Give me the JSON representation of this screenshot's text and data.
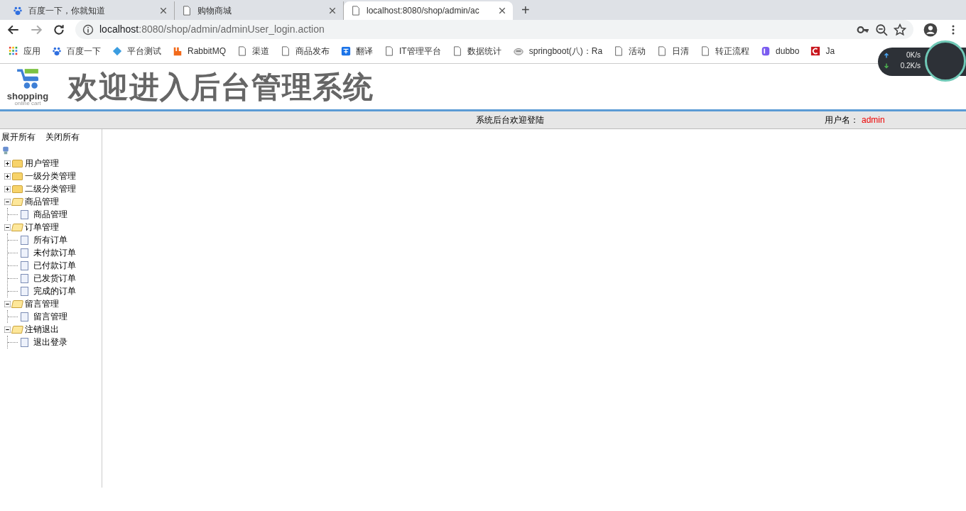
{
  "browser": {
    "tabs": [
      {
        "title": "百度一下，你就知道",
        "kind": "paw",
        "selected": false
      },
      {
        "title": "购物商城",
        "kind": "page",
        "selected": false
      },
      {
        "title": "localhost:8080/shop/admin/ac",
        "kind": "page",
        "selected": true
      }
    ],
    "new_tab": "+",
    "address": {
      "host": "localhost",
      "rest": ":8080/shop/admin/adminUser_login.action"
    },
    "bookmarks": [
      {
        "label": "应用",
        "kind": "apps"
      },
      {
        "label": "百度一下",
        "kind": "paw"
      },
      {
        "label": "平台测试",
        "kind": "diamond"
      },
      {
        "label": "RabbitMQ",
        "kind": "rabbit"
      },
      {
        "label": "渠道",
        "kind": "page"
      },
      {
        "label": "商品发布",
        "kind": "page"
      },
      {
        "label": "翻译",
        "kind": "translate"
      },
      {
        "label": "IT管理平台",
        "kind": "page"
      },
      {
        "label": "数据统计",
        "kind": "page"
      },
      {
        "label": "springboot(八)：Ra",
        "kind": "cloud"
      },
      {
        "label": "活动",
        "kind": "page"
      },
      {
        "label": "日清",
        "kind": "page"
      },
      {
        "label": "转正流程",
        "kind": "page"
      },
      {
        "label": "dubbo",
        "kind": "dubbo"
      },
      {
        "label": "Ja",
        "kind": "csdn"
      }
    ],
    "speed": {
      "up": "0",
      "up_unit": "K/s",
      "down": "0.2",
      "down_unit": "K/s"
    }
  },
  "header": {
    "logo_text": "shopping",
    "logo_sub": "online cart",
    "title": "欢迎进入后台管理系统"
  },
  "status_bar": {
    "welcome": "系统后台欢迎登陆",
    "user_label": "用户名：",
    "user": "admin"
  },
  "sidebar": {
    "expand_all": "展开所有",
    "collapse_all": "关闭所有",
    "tree": [
      {
        "label": "用户管理",
        "expanded": false
      },
      {
        "label": "一级分类管理",
        "expanded": false
      },
      {
        "label": "二级分类管理",
        "expanded": false
      },
      {
        "label": "商品管理",
        "expanded": true,
        "children": [
          {
            "label": "商品管理"
          }
        ]
      },
      {
        "label": "订单管理",
        "expanded": true,
        "children": [
          {
            "label": "所有订单"
          },
          {
            "label": "未付款订单"
          },
          {
            "label": "已付款订单"
          },
          {
            "label": "已发货订单"
          },
          {
            "label": "完成的订单"
          }
        ]
      },
      {
        "label": "留言管理",
        "expanded": true,
        "children": [
          {
            "label": "留言管理"
          }
        ]
      },
      {
        "label": "注销退出",
        "expanded": true,
        "children": [
          {
            "label": "退出登录"
          }
        ]
      }
    ]
  }
}
